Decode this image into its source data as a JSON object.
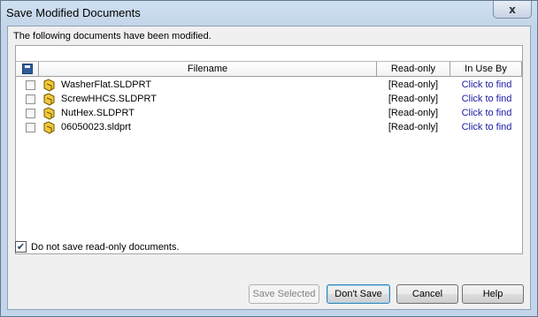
{
  "window": {
    "title": "Save Modified Documents",
    "close_glyph": "x"
  },
  "message": "The following documents have been modified.",
  "table": {
    "columns": {
      "save_icon": "save-icon",
      "filename": "Filename",
      "readonly": "Read-only",
      "inuse": "In Use By"
    },
    "rows": [
      {
        "checked": false,
        "filename": "WasherFlat.SLDPRT",
        "readonly": "[Read-only]",
        "inuse": "Click to find"
      },
      {
        "checked": false,
        "filename": "ScrewHHCS.SLDPRT",
        "readonly": "[Read-only]",
        "inuse": "Click to find"
      },
      {
        "checked": false,
        "filename": "NutHex.SLDPRT",
        "readonly": "[Read-only]",
        "inuse": "Click to find"
      },
      {
        "checked": false,
        "filename": "06050023.sldprt",
        "readonly": "[Read-only]",
        "inuse": "Click to find"
      }
    ]
  },
  "option": {
    "checked": true,
    "label": "Do not save read-only documents."
  },
  "buttons": {
    "save_selected": "Save Selected",
    "dont_save": "Don't Save",
    "cancel": "Cancel",
    "help": "Help"
  }
}
